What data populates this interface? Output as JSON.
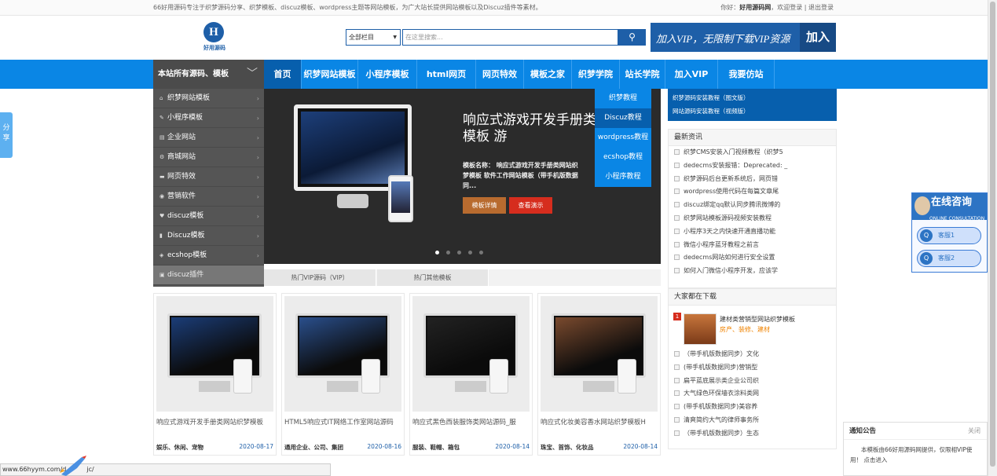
{
  "topbar": {
    "tagline": "66好用源码专注于织梦源码分享、织梦模板、discuz模板、wordpress主题等网站模板，为广大站长提供网站模板以及Discuz插件等素材。",
    "hello": "你好：",
    "site": "好用源码网",
    "welcome": "，欢迎登录",
    "logout": "退出登录",
    "sep": "|"
  },
  "logo": {
    "mark": "H",
    "text": "好用源码"
  },
  "search": {
    "select": "全部栏目",
    "placeholder": "在这里搜索...",
    "btn_icon": "search-icon"
  },
  "vip": {
    "text": "加入VIP，无限制下载VIP资源",
    "btn": "加入"
  },
  "allcat": {
    "label": "本站所有源码、模板",
    "icon": "chevron-down-icon"
  },
  "nav": [
    "首页",
    "织梦网站模板",
    "小程序模板",
    "html网页",
    "网页特效",
    "模板之家",
    "织梦学院",
    "站长学院",
    "加入VIP",
    "我要仿站"
  ],
  "side": [
    {
      "label": "织梦网站模板",
      "icon": "house-icon"
    },
    {
      "label": "小程序模板",
      "icon": "leaf-icon"
    },
    {
      "label": "企业网站",
      "icon": "building-icon"
    },
    {
      "label": "商城网站",
      "icon": "gear-icon"
    },
    {
      "label": "网页特效",
      "icon": "car-icon"
    },
    {
      "label": "营销软件",
      "icon": "eye-icon"
    },
    {
      "label": "discuz模板",
      "icon": "heart-icon"
    },
    {
      "label": "Discuz模板",
      "icon": "bars-icon"
    },
    {
      "label": "ecshop模板",
      "icon": "cart-icon"
    },
    {
      "label": "discuz插件",
      "icon": "plugin-icon"
    }
  ],
  "hero": {
    "title": "响应式游戏开发手册类网站织梦模板 游",
    "desc": "模板名称： 响应式游戏开发手册类网站织梦模板 软件工作网站模板（带手机版数据同...",
    "btn1": "模板详情",
    "btn2": "查看演示",
    "slides": 5,
    "active": 0
  },
  "dropdown": [
    "织梦教程",
    "Discuz教程",
    "wordpress教程",
    "ecshop教程",
    "小程序教程"
  ],
  "tabs": [
    "热门VIP源码（VIP）",
    "热门其他模板"
  ],
  "cards": [
    {
      "title": "响应式游戏开发手册类网站织梦模板",
      "tags": "娱乐、休闲、宠物",
      "date": "2020-08-17",
      "screen": "#1b3d78"
    },
    {
      "title": "HTML5响应式IT网络工作室网站源码",
      "tags": "通用企业、公司、集团",
      "date": "2020-08-16",
      "screen": "#2a4f8c"
    },
    {
      "title": "响应式黑色西装服饰类网站源码_服",
      "tags": "服装、鞋帽、箱包",
      "date": "2020-08-14",
      "screen": "#222222"
    },
    {
      "title": "响应式化妆美容香水网站织梦模板H",
      "tags": "珠宝、首饰、化妆品",
      "date": "2020-08-14",
      "screen": "#7a4a2e"
    }
  ],
  "right_links": [
    "织梦源码安装教程（图文版）",
    "网站源码安装教程（视频版）"
  ],
  "latest": {
    "title": "最新资讯",
    "items": [
      "织梦CMS安装入门视频教程（织梦5",
      "dedecms安装报错：Deprecated: _",
      "织梦源码后台更新系统后，网页错",
      "wordpress使用代码在每篇文章尾",
      "discuz绑定qq默认同步腾讯微博的",
      "织梦网站模板源码视频安装教程",
      "小程序3天之内快速开通直播功能",
      "微信小程序蓝牙教程之前言",
      "dedecms网站如何进行安全设置",
      "如何入门微信小程序开发，应该学"
    ]
  },
  "downloads": {
    "title": "大家都在下载",
    "top": {
      "rank": "1",
      "title": "建材类营销型网站织梦模板",
      "tags": "房产、装修、建材"
    },
    "items": [
      "（带手机版数据同步）文化",
      "(带手机版数据同步)营销型",
      "扁平蓝底展示类企业公司织",
      "大气绿色环保墙衣涂料类网",
      "(带手机版数据同步)美容养",
      "清爽简约大气的律师事务所",
      "（带手机版数据同步）生态"
    ]
  },
  "share": {
    "label": "分享"
  },
  "online": {
    "title": "在线咨询",
    "sub": "ONLINE CONSULTATION",
    "qq1": "客服1",
    "qq2": "客服2"
  },
  "notice": {
    "title": "通知公告",
    "close": "关闭",
    "body": "本模板由66好用源码网提供，仅限相VIP使用！ 点击进入"
  },
  "status": {
    "url": "www.66hyym.com/d",
    "url2": "jc/"
  }
}
